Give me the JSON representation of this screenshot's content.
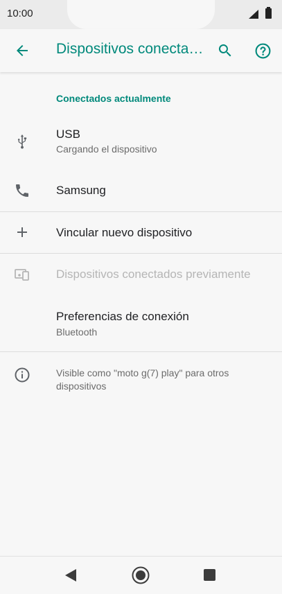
{
  "status_bar": {
    "time": "10:00"
  },
  "app_bar": {
    "title": "Dispositivos conectados",
    "icons": [
      "back-arrow-icon",
      "search-icon",
      "help-icon"
    ]
  },
  "section_header": "Conectados actualmente",
  "items": [
    {
      "icon": "usb-icon",
      "title": "USB",
      "subtitle": "Cargando el dispositivo"
    },
    {
      "icon": "phone-icon",
      "title": "Samsung"
    },
    {
      "icon": "plus-icon",
      "title": "Vincular nuevo dispositivo"
    },
    {
      "icon": "devices-icon",
      "title": "Dispositivos conectados previamente"
    },
    {
      "title": "Preferencias de conexión",
      "subtitle": "Bluetooth"
    }
  ],
  "footer": {
    "icon": "info-icon",
    "text": "Visible como \"moto g(7) play\" para otros dispositivos"
  },
  "nav_bar": {
    "icons": [
      "back-triangle-icon",
      "home-circle-icon",
      "recents-square-icon"
    ]
  },
  "colors": {
    "accent": "#00897b",
    "background": "#f7f7f7",
    "status_bar": "#ebebeb"
  }
}
